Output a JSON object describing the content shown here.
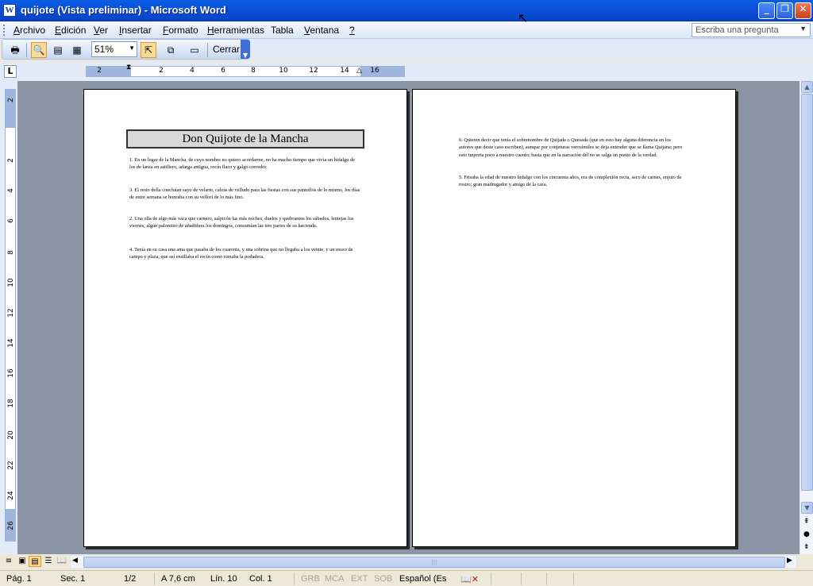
{
  "window": {
    "title": "quijote (Vista preliminar) - Microsoft Word",
    "app_icon": "W",
    "minimize": "_",
    "maximize": "❐",
    "close": "✕"
  },
  "menu": {
    "items": [
      {
        "label": "Archivo",
        "key": "A",
        "rest": "rchivo"
      },
      {
        "label": "Edición",
        "key": "E",
        "rest": "dición"
      },
      {
        "label": "Ver",
        "key": "V",
        "rest": "er"
      },
      {
        "label": "Insertar",
        "key": "I",
        "rest": "nsertar"
      },
      {
        "label": "Formato",
        "key": "F",
        "rest": "ormato"
      },
      {
        "label": "Herramientas",
        "key": "H",
        "rest": "erramientas"
      },
      {
        "label": "Tabla",
        "key": "T",
        "rest": "abla"
      },
      {
        "label": "Ventana",
        "key": "V",
        "rest": "entana"
      },
      {
        "label": "?",
        "key": "?",
        "rest": ""
      }
    ],
    "help_placeholder": "Escriba una pregunta"
  },
  "toolbar": {
    "zoom": "51%",
    "close_label": "Cerrar"
  },
  "ruler": {
    "tab_selector": "L",
    "h_numbers": [
      "2",
      "2",
      "4",
      "6",
      "8",
      "10",
      "12",
      "14",
      "16"
    ],
    "v_numbers": [
      "2",
      "2",
      "4",
      "6",
      "8",
      "10",
      "12",
      "14",
      "16",
      "18",
      "20",
      "22",
      "24",
      "26"
    ]
  },
  "document": {
    "title": "Don Quijote de la Mancha",
    "page1_paragraphs": [
      "1. En un lugar de la Mancha, de cuyo nombre no quiero acordarme, no ha mucho tiempo que vivía un hidalgo de los de lanza en astillero, adarga antigua, rocín flaco y galgo corredor.",
      "3. El resto della concluían sayo de velarte, calzas de velludo para las fiestas con sus pantuflos de lo mismo, los días de entre semana se honraba con su vellorí de lo más fino.",
      "2. Una olla de algo más vaca que carnero, salpicón las más noches, duelos y quebrantos los sábados, lentejas los viernes, algún palomino de añadidura los domingos, consumían las tres partes de su hacienda.",
      "4. Tenía en su casa una ama que pasaba de los cuarenta, y una sobrina que no llegaba a los veinte, y un mozo de campo y plaza, que así ensillaba el rocín como tomaba la podadera."
    ],
    "page2_paragraphs": [
      "6. Quieren decir que tenía el sobrenombre de Quijada o Quesada (que en esto hay alguna diferencia en los autores que deste caso escriben), aunque por conjeturas verosímiles se deja entender que se llama Quijana; pero esto importa poco a nuestro cuento; basta que en la narración dél no se salga un punto de la verdad.",
      "5. Frisaba la edad de nuestro hidalgo con los cincuenta años, era de complexión recia, seco de carnes, enjuto de rostro; gran madrugador y amigo de la caza."
    ]
  },
  "statusbar": {
    "page": "Pág. 1",
    "section": "Sec. 1",
    "pages": "1/2",
    "at": "A 7,6 cm",
    "line": "Lín. 10",
    "col": "Col. 1",
    "grb": "GRB",
    "mca": "MCA",
    "ext": "EXT",
    "sob": "SOB",
    "lang": "Español (Es"
  }
}
